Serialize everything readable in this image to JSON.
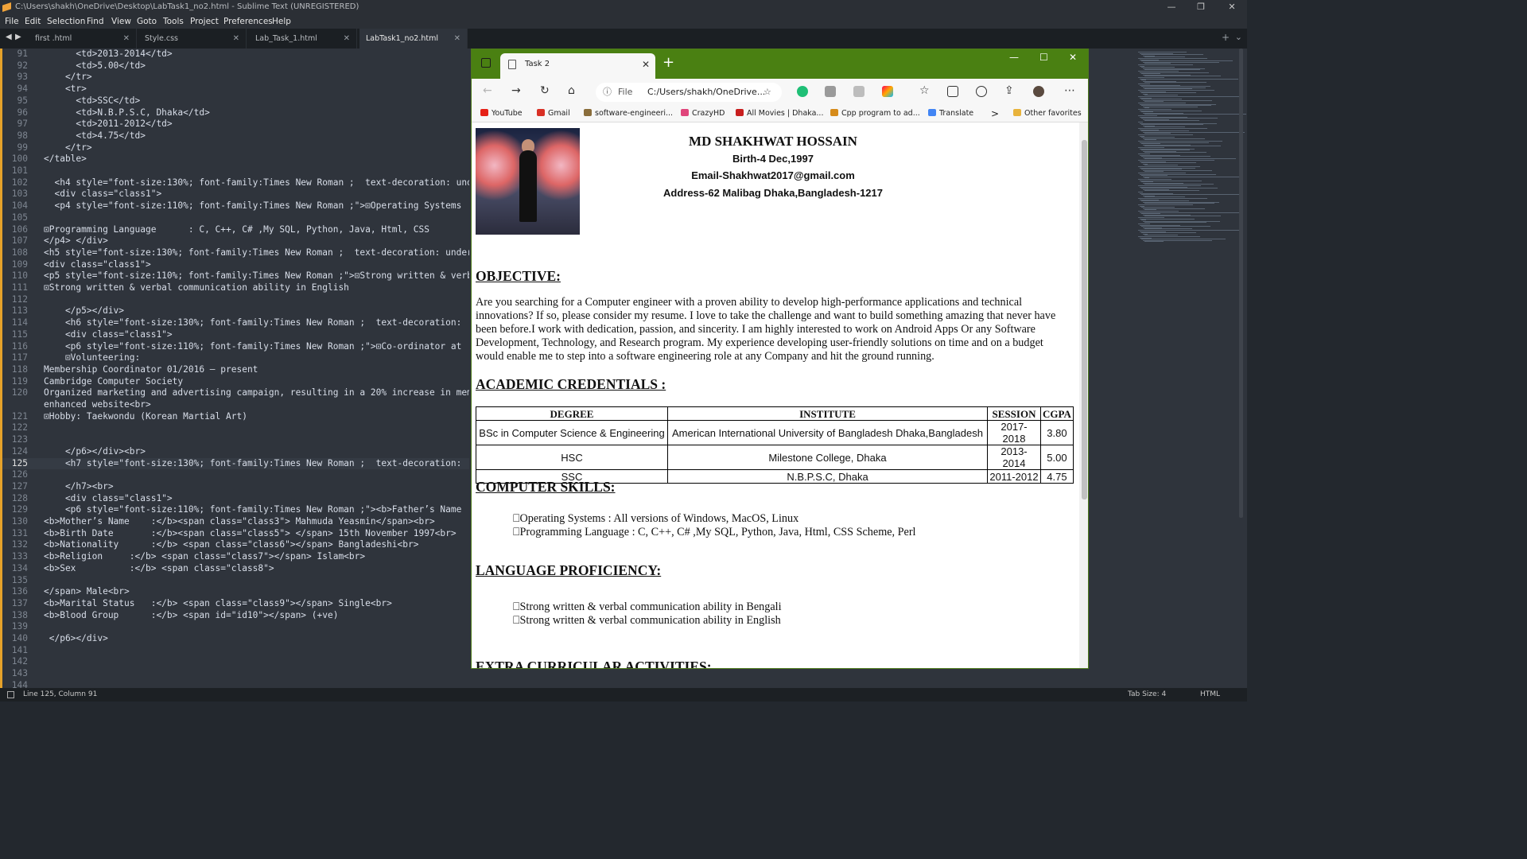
{
  "window": {
    "title": "C:\\Users\\shakh\\OneDrive\\Desktop\\LabTask1_no2.html - Sublime Text (UNREGISTERED)",
    "minimize_glyph": "—",
    "maximize_glyph": "❐",
    "close_glyph": "✕"
  },
  "menu": [
    "File",
    "Edit",
    "Selection",
    "Find",
    "View",
    "Goto",
    "Tools",
    "Project",
    "Preferences",
    "Help"
  ],
  "tabs": [
    {
      "label": "first .html"
    },
    {
      "label": "Style.css"
    },
    {
      "label": "Lab_Task_1.html"
    },
    {
      "label": "LabTask1_no2.html",
      "active": true
    }
  ],
  "editor": {
    "lines": [
      {
        "n": "91",
        "t": "      <td>2013-2014</td>"
      },
      {
        "n": "92",
        "t": "      <td>5.00</td>"
      },
      {
        "n": "93",
        "t": "    </tr>"
      },
      {
        "n": "94",
        "t": "    <tr>"
      },
      {
        "n": "95",
        "t": "      <td>SSC</td>"
      },
      {
        "n": "96",
        "t": "      <td>N.B.P.S.C, Dhaka</td>"
      },
      {
        "n": "97",
        "t": "      <td>2011-2012</td>"
      },
      {
        "n": "98",
        "t": "      <td>4.75</td>"
      },
      {
        "n": "99",
        "t": "    </tr>"
      },
      {
        "n": "100",
        "t": "</table>"
      },
      {
        "n": "101",
        "t": ""
      },
      {
        "n": "102",
        "t": "  <h4 style=\"font-size:130%; font-family:Times New Roman ;  text-decoration: und"
      },
      {
        "n": "103",
        "t": "  <div class=\"class1\">"
      },
      {
        "n": "104",
        "t": "  <p4 style=\"font-size:110%; font-family:Times New Roman ;\">⊡Operating Systems"
      },
      {
        "n": "105",
        "t": ""
      },
      {
        "n": "106",
        "t": "⊡Programming Language      : C, C++, C# ,My SQL, Python, Java, Html, CSS"
      },
      {
        "n": "107",
        "t": "</p4> </div>"
      },
      {
        "n": "108",
        "t": "<h5 style=\"font-size:130%; font-family:Times New Roman ;  text-decoration: under"
      },
      {
        "n": "109",
        "t": "<div class=\"class1\">"
      },
      {
        "n": "110",
        "t": "<p5 style=\"font-size:110%; font-family:Times New Roman ;\">⊡Strong written & verb"
      },
      {
        "n": "111",
        "t": "⊡Strong written & verbal communication ability in English"
      },
      {
        "n": "112",
        "t": ""
      },
      {
        "n": "113",
        "t": "    </p5></div>"
      },
      {
        "n": "114",
        "t": "    <h6 style=\"font-size:130%; font-family:Times New Roman ;  text-decoration: "
      },
      {
        "n": "115",
        "t": "    <div class=\"class1\">"
      },
      {
        "n": "116",
        "t": "    <p6 style=\"font-size:110%; font-family:Times New Roman ;\">⊡Co-ordinator at "
      },
      {
        "n": "117",
        "t": "    ⊡Volunteering:"
      },
      {
        "n": "118",
        "t": "Membership Coordinator 01/2016 – present"
      },
      {
        "n": "119",
        "t": "Cambridge Computer Society"
      },
      {
        "n": "120",
        "t": "Organized marketing and advertising campaign, resulting in a 20% increase in mem"
      },
      {
        "n": "",
        "t": "enhanced website<br>"
      },
      {
        "n": "121",
        "t": "⊡Hobby: Taekwondu (Korean Martial Art)"
      },
      {
        "n": "122",
        "t": ""
      },
      {
        "n": "123",
        "t": ""
      },
      {
        "n": "124",
        "t": "    </p6></div><br>"
      },
      {
        "n": "125",
        "t": "    <h7 style=\"font-size:130%; font-family:Times New Roman ;  text-decoration: ",
        "cur": true
      },
      {
        "n": "126",
        "t": ""
      },
      {
        "n": "127",
        "t": "    </h7><br>"
      },
      {
        "n": "128",
        "t": "    <div class=\"class1\">"
      },
      {
        "n": "129",
        "t": "    <p6 style=\"font-size:110%; font-family:Times New Roman ;\"><b>Father’s Name"
      },
      {
        "n": "130",
        "t": "<b>Mother’s Name    :</b><span class=\"class3\"> Mahmuda Yeasmin</span><br>"
      },
      {
        "n": "131",
        "t": "<b>Birth Date       :</b><span class=\"class5\"> </span> 15th November 1997<br>"
      },
      {
        "n": "132",
        "t": "<b>Nationality      :</b> <span class=\"class6\"></span> Bangladeshi<br>"
      },
      {
        "n": "133",
        "t": "<b>Religion     :</b> <span class=\"class7\"></span> Islam<br>"
      },
      {
        "n": "134",
        "t": "<b>Sex          :</b> <span class=\"class8\">"
      },
      {
        "n": "135",
        "t": ""
      },
      {
        "n": "136",
        "t": "</span> Male<br>"
      },
      {
        "n": "137",
        "t": "<b>Marital Status   :</b> <span class=\"class9\"></span> Single<br>"
      },
      {
        "n": "138",
        "t": "<b>Blood Group      :</b> <span id=\"id10\"></span> (+ve)"
      },
      {
        "n": "139",
        "t": ""
      },
      {
        "n": "140",
        "t": " </p6></div>"
      },
      {
        "n": "141",
        "t": ""
      },
      {
        "n": "142",
        "t": ""
      },
      {
        "n": "143",
        "t": ""
      },
      {
        "n": "144",
        "t": ""
      }
    ]
  },
  "status": {
    "position": "Line 125, Column 91",
    "tab_size": "Tab Size: 4",
    "syntax": "HTML"
  },
  "browser": {
    "tab_title": "Task 2",
    "url_label": "File",
    "url": "C:/Users/shakh/OneDrive...",
    "favorites": [
      {
        "label": "YouTube",
        "color": "#e62117"
      },
      {
        "label": "Gmail",
        "color": "#d93025"
      },
      {
        "label": "software-engineeri...",
        "color": "#8a6d3b"
      },
      {
        "label": "CrazyHD",
        "color": "#e0457b"
      },
      {
        "label": "All Movies | Dhaka...",
        "color": "#c81e1e"
      },
      {
        "label": "Cpp program to ad...",
        "color": "#d68b1a"
      },
      {
        "label": "Translate",
        "color": "#4285f4"
      }
    ],
    "more_favorites": ">",
    "other_favorites": "Other favorites"
  },
  "resume": {
    "name": "MD SHAKHWAT HOSSAIN",
    "birth": "Birth-4 Dec,1997",
    "email": "Email-Shakhwat2017@gmail.com",
    "address": "Address-62 Malibag Dhaka,Bangladesh-1217",
    "objective_title": "OBJECTIVE:",
    "objective_text": "Are you searching for a Computer engineer with a proven ability to develop high-performance applications and technical innovations? If so, please consider my resume. I love to take the challenge and want to build something amazing that never have been before.I work with dedication, passion, and sincerity. I am highly interested to work on Android Apps Or any Software Development, Technology, and Research program. My experience developing user-friendly solutions on time and on a budget would enable me to step into a software engineering role at any Company and hit the ground running.",
    "academic_title": "ACADEMIC CREDENTIALS :",
    "academic_headers": [
      "DEGREE",
      "INSTITUTE",
      "SESSION",
      "CGPA"
    ],
    "academic_rows": [
      [
        "BSc in Computer Science & Engineering",
        "American International University of Bangladesh Dhaka,Bangladesh",
        "2017-2018",
        "3.80"
      ],
      [
        "HSC",
        "Milestone College, Dhaka",
        "2013-2014",
        "5.00"
      ],
      [
        "SSC",
        "N.B.P.S.C, Dhaka",
        "2011-2012",
        "4.75"
      ]
    ],
    "skills_title": "COMPUTER SKILLS:",
    "skills": [
      "⎕Operating Systems : All versions of Windows, MacOS, Linux",
      "⎕Programming Language : C, C++, C# ,My SQL, Python, Java, Html, CSS Scheme, Perl"
    ],
    "language_title": "LANGUAGE PROFICIENCY:",
    "languages": [
      "⎕Strong written & verbal communication ability in Bengali",
      "⎕Strong written & verbal communication ability in English"
    ],
    "extra_title": "EXTRA CURRICULAR ACTIVITIES:"
  }
}
